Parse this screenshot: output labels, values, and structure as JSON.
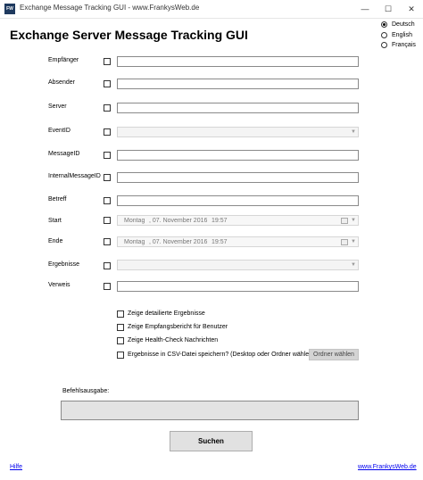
{
  "window": {
    "icon_text": "FW",
    "title": "Exchange Message Tracking GUI - www.FrankysWeb.de",
    "minimize": "—",
    "maximize": "☐",
    "close": "✕"
  },
  "heading": "Exchange Server Message Tracking GUI",
  "languages": [
    {
      "label": "Deutsch",
      "selected": true
    },
    {
      "label": "English",
      "selected": false
    },
    {
      "label": "Français",
      "selected": false
    }
  ],
  "fields": {
    "recipient": {
      "label": "Empfänger",
      "value": ""
    },
    "sender": {
      "label": "Absender",
      "value": ""
    },
    "server": {
      "label": "Server",
      "value": ""
    },
    "event_id": {
      "label": "EventID",
      "value": ""
    },
    "message_id": {
      "label": "MessageID",
      "value": ""
    },
    "internal_message_id": {
      "label": "InternalMessageID",
      "value": ""
    },
    "subject": {
      "label": "Betreff",
      "value": ""
    },
    "start": {
      "label": "Start",
      "weekday": "Montag",
      "date": ", 07. November 2016",
      "time": "19:57"
    },
    "end": {
      "label": "Ende",
      "weekday": "Montag",
      "date": ", 07. November 2016",
      "time": "19:57"
    },
    "results": {
      "label": "Ergebnisse",
      "value": ""
    },
    "reference": {
      "label": "Verweis",
      "value": ""
    }
  },
  "options": {
    "detailed": "Zeige detailierte Ergebnisse",
    "receipt_report": "Zeige Empfangsbericht für Benutzer",
    "health_check": "Zeige Health-Check Nachrichten",
    "save_csv": "Ergebnisse in CSV-Datei speichern? (Desktop oder Ordner wählen)"
  },
  "folder_button": "Ordner wählen",
  "output_label": "Befehlsausgabe:",
  "search_button": "Suchen",
  "footer": {
    "help_link": "Hilfe",
    "site_link": "www.FrankysWeb.de"
  }
}
